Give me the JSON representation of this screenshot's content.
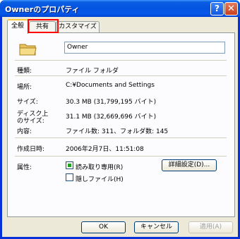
{
  "window": {
    "title": "Ownerのプロパティ"
  },
  "titlebar": {
    "help_glyph": "?",
    "close_glyph": "✕"
  },
  "tabs": [
    {
      "label": "全般"
    },
    {
      "label": "共有"
    },
    {
      "label": "カスタマイズ"
    }
  ],
  "general": {
    "name_value": "Owner",
    "type_label": "種類:",
    "type_value": "ファイル フォルダ",
    "location_label": "場所:",
    "location_value": "C:¥Documents and Settings",
    "size_label": "サイズ:",
    "size_value": "30.3 MB (31,799,195 バイト)",
    "disk_size_label_1": "ディスク上",
    "disk_size_label_2": "のサイズ:",
    "disk_size_value": "31.1 MB (32,669,696 バイト)",
    "contents_label": "内容:",
    "contents_value": "ファイル数: 311、フォルダ数: 145",
    "created_label": "作成日時:",
    "created_value": "2006年2月7日、11:51:08",
    "attributes_label": "属性:",
    "readonly_label": "読み取り専用(R)",
    "hidden_label": "隠しファイル(H)",
    "advanced_button": "詳細設定(D)..."
  },
  "footer": {
    "ok": "OK",
    "cancel": "キャンセル",
    "apply": "適用(A)"
  },
  "colors": {
    "title_bar": "#0453df",
    "highlight": "#ff0000",
    "tab_accent": "#ffc73c"
  },
  "icons": {
    "folder": "folder-icon",
    "help": "help-icon",
    "close": "close-icon"
  }
}
